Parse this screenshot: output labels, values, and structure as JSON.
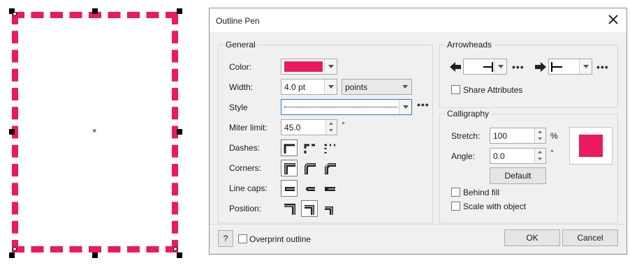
{
  "dialog": {
    "title": "Outline Pen",
    "close_icon": "close-icon"
  },
  "general": {
    "legend": "General",
    "color_label": "Color:",
    "color_value": "#ea1a5c",
    "width_label": "Width:",
    "width_value": "4.0 pt",
    "width_unit": "points",
    "style_label": "Style",
    "miter_label": "Miter limit:",
    "miter_value": "45.0",
    "miter_unit": "°",
    "dashes_label": "Dashes:",
    "corners_label": "Corners:",
    "linecaps_label": "Line caps:",
    "position_label": "Position:"
  },
  "arrowheads": {
    "legend": "Arrowheads",
    "share_label": "Share Attributes"
  },
  "calligraphy": {
    "legend": "Calligraphy",
    "stretch_label": "Stretch:",
    "stretch_value": "100",
    "stretch_unit": "%",
    "angle_label": "Angle:",
    "angle_value": "0.0",
    "angle_unit": "°",
    "default_label": "Default",
    "preview_color": "#ea1a5c"
  },
  "options": {
    "behind_fill_label": "Behind fill",
    "scale_label": "Scale with object"
  },
  "footer": {
    "help_label": "?",
    "overprint_label": "Overprint outline",
    "ok_label": "OK",
    "cancel_label": "Cancel"
  },
  "canvas": {
    "outline_color": "#ea1a5c",
    "center_mark": "×"
  }
}
